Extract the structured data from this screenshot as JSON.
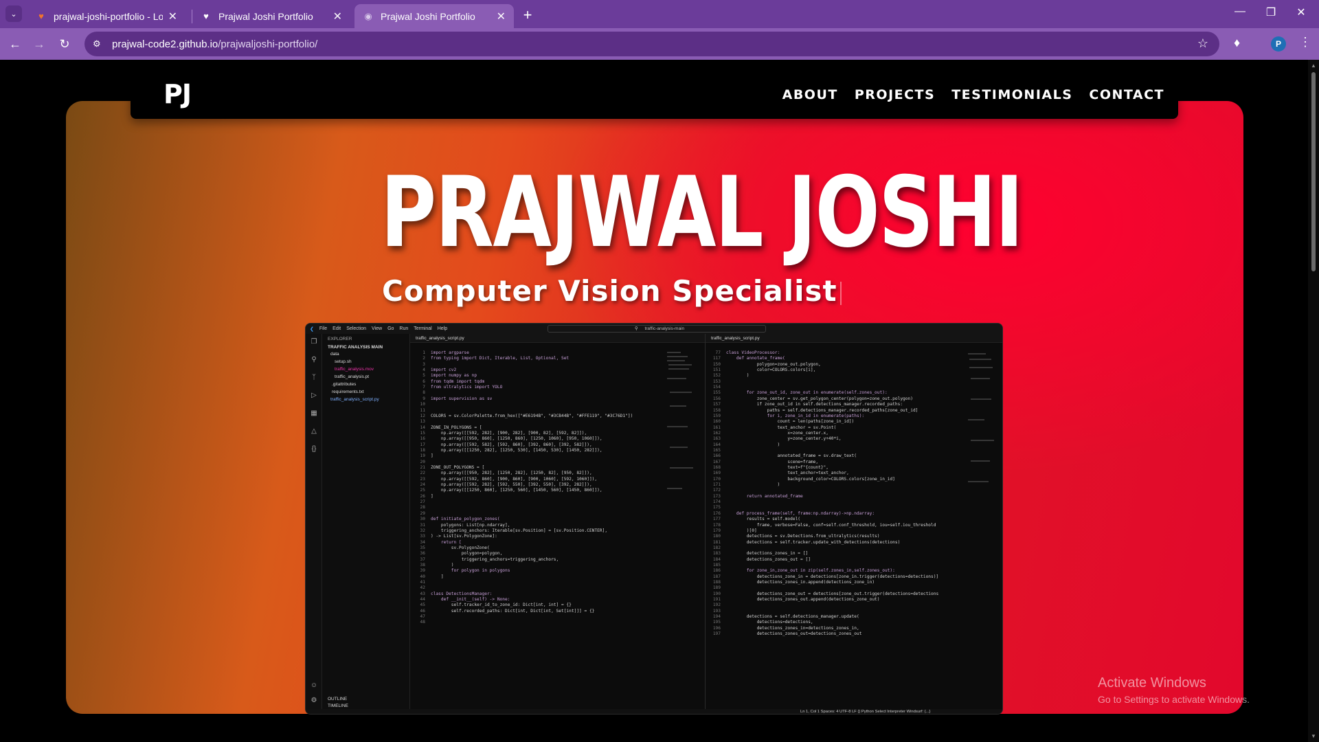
{
  "browser": {
    "tabs": [
      {
        "title": "prajwal-joshi-portfolio - Lovabl",
        "favicon": "lovable-heart-icon",
        "active": false
      },
      {
        "title": "Prajwal Joshi Portfolio",
        "favicon": "heart-icon",
        "active": false
      },
      {
        "title": "Prajwal Joshi Portfolio",
        "favicon": "globe-icon",
        "active": true
      }
    ],
    "url_host": "prajwal-code2.github.io",
    "url_path": "/prajwaljoshi-portfolio/",
    "profile_initial": "P",
    "colors": {
      "frame": "#6b3c9a",
      "toolbar": "#8a5cb4",
      "omnibox": "#5c2f86"
    }
  },
  "site": {
    "logo": "PJ",
    "nav": [
      "ABOUT",
      "PROJECTS",
      "TESTIMONIALS",
      "CONTACT"
    ],
    "hero_name": "PRAJWAL JOSHI",
    "hero_role": "Computer Vision Specialist",
    "colors": {
      "accent_red": "#e2082c",
      "accent_orange": "#d85a1a"
    }
  },
  "ide": {
    "menu": [
      "File",
      "Edit",
      "Selection",
      "View",
      "Go",
      "Run",
      "Terminal",
      "Help"
    ],
    "search": "traffic-analysis-main",
    "explorer_header": "EXPLORER",
    "project": "TRAFFIC ANALYSIS MAIN",
    "files": [
      "data",
      "setup.sh",
      "traffic_analysis.mov",
      "traffic_analysis.pt",
      ".gitattributes",
      "requirements.txt",
      "traffic_analysis_script.py"
    ],
    "outline": "OUTLINE",
    "timeline": "TIMELINE",
    "tab_left": "traffic_analysis_script.py",
    "tab_right": "traffic_analysis_script.py",
    "left_lines": [
      [
        "1",
        "import argparse"
      ],
      [
        "2",
        "from typing import Dict, Iterable, List, Optional, Set"
      ],
      [
        "3",
        ""
      ],
      [
        "4",
        "import cv2"
      ],
      [
        "5",
        "import numpy as np"
      ],
      [
        "6",
        "from tqdm import tqdm"
      ],
      [
        "7",
        "from ultralytics import YOLO"
      ],
      [
        "8",
        ""
      ],
      [
        "9",
        "import supervision as sv"
      ],
      [
        "10",
        ""
      ],
      [
        "11",
        ""
      ],
      [
        "12",
        "COLORS = sv.ColorPalette.from_hex([\"#E6194B\", \"#3CB44B\", \"#FFE119\", \"#3C76D1\"])"
      ],
      [
        "13",
        ""
      ],
      [
        "14",
        "ZONE_IN_POLYGONS = ["
      ],
      [
        "15",
        "    np.array([[592, 282], [900, 282], [900, 82], [592, 82]]),"
      ],
      [
        "16",
        "    np.array([[950, 860], [1250, 860], [1250, 1060], [950, 1060]]),"
      ],
      [
        "17",
        "    np.array([[592, 582], [592, 860], [392, 860], [392, 582]]),"
      ],
      [
        "18",
        "    np.array([[1250, 282], [1250, 530], [1450, 530], [1450, 282]]),"
      ],
      [
        "19",
        "]"
      ],
      [
        "20",
        ""
      ],
      [
        "21",
        "ZONE_OUT_POLYGONS = ["
      ],
      [
        "22",
        "    np.array([[950, 282], [1250, 282], [1250, 82], [950, 82]]),"
      ],
      [
        "23",
        "    np.array([[592, 860], [900, 860], [900, 1060], [592, 1060]]),"
      ],
      [
        "24",
        "    np.array([[592, 282], [592, 550], [392, 550], [392, 282]]),"
      ],
      [
        "25",
        "    np.array([[1250, 860], [1250, 560], [1450, 560], [1450, 860]]),"
      ],
      [
        "26",
        "]"
      ],
      [
        "27",
        ""
      ],
      [
        "28",
        ""
      ],
      [
        "29",
        ""
      ],
      [
        "30",
        "def initiate_polygon_zones("
      ],
      [
        "31",
        "    polygons: List[np.ndarray],"
      ],
      [
        "32",
        "    triggering_anchors: Iterable[sv.Position] = [sv.Position.CENTER],"
      ],
      [
        "33",
        ") -> List[sv.PolygonZone]:"
      ],
      [
        "34",
        "    return ["
      ],
      [
        "35",
        "        sv.PolygonZone("
      ],
      [
        "36",
        "            polygon=polygon,"
      ],
      [
        "37",
        "            triggering_anchors=triggering_anchors,"
      ],
      [
        "38",
        "        )"
      ],
      [
        "39",
        "        for polygon in polygons"
      ],
      [
        "40",
        "    ]"
      ],
      [
        "41",
        ""
      ],
      [
        "42",
        ""
      ],
      [
        "43",
        "class DetectionsManager:"
      ],
      [
        "44",
        "    def __init__(self) -> None:"
      ],
      [
        "45",
        "        self.tracker_id_to_zone_id: Dict[int, int] = {}"
      ],
      [
        "46",
        "        self.recorded_paths: Dict[int, Dict[int, Set[int]]] = {}"
      ],
      [
        "47",
        ""
      ],
      [
        "48",
        ""
      ]
    ],
    "right_lines": [
      [
        "77",
        "class VideoProcessor:"
      ],
      [
        "117",
        "    def annotate_frame("
      ],
      [
        "150",
        "            polygon=zone_out.polygon,"
      ],
      [
        "151",
        "            color=COLORS.colors[i],"
      ],
      [
        "152",
        "        )"
      ],
      [
        "153",
        ""
      ],
      [
        "154",
        ""
      ],
      [
        "155",
        "        for zone_out_id, zone_out in enumerate(self.zones_out):"
      ],
      [
        "156",
        "            zone_center = sv.get_polygon_center(polygon=zone_out.polygon)"
      ],
      [
        "157",
        "            if zone_out_id in self.detections_manager.recorded_paths:"
      ],
      [
        "158",
        "                paths = self.detections_manager.recorded_paths[zone_out_id]"
      ],
      [
        "159",
        "                for i, zone_in_id in enumerate(paths):"
      ],
      [
        "160",
        "                    count = len(paths[zone_in_id])"
      ],
      [
        "161",
        "                    text_anchor = sv.Point("
      ],
      [
        "162",
        "                        x=zone_center.x,"
      ],
      [
        "163",
        "                        y=zone_center.y+40*i,"
      ],
      [
        "164",
        "                    )"
      ],
      [
        "165",
        ""
      ],
      [
        "166",
        "                    annotated_frame = sv.draw_text("
      ],
      [
        "167",
        "                        scene=frame,"
      ],
      [
        "168",
        "                        text=f\"{count}\","
      ],
      [
        "169",
        "                        text_anchor=text_anchor,"
      ],
      [
        "170",
        "                        background_color=COLORS.colors[zone_in_id]"
      ],
      [
        "171",
        "                    )"
      ],
      [
        "172",
        ""
      ],
      [
        "173",
        "        return annotated_frame"
      ],
      [
        "174",
        ""
      ],
      [
        "175",
        ""
      ],
      [
        "176",
        "    def process_frame(self, frame:np.ndarray)->np.ndarray:"
      ],
      [
        "177",
        "        results = self.model("
      ],
      [
        "178",
        "            frame, verbose=False, conf=self.conf_threshold, iou=self.iou_threshold"
      ],
      [
        "179",
        "        )[0]"
      ],
      [
        "180",
        "        detections = sv.Detections.from_ultralytics(results)"
      ],
      [
        "181",
        "        detections = self.tracker.update_with_detections(detections)"
      ],
      [
        "182",
        ""
      ],
      [
        "183",
        "        detections_zones_in = []"
      ],
      [
        "184",
        "        detections_zones_out = []"
      ],
      [
        "185",
        ""
      ],
      [
        "186",
        "        for zone_in,zone_out in zip(self.zones_in,self.zones_out):"
      ],
      [
        "187",
        "            detections_zone_in = detections[zone_in.trigger(detections=detections)]"
      ],
      [
        "188",
        "            detections_zones_in.append(detections_zone_in)"
      ],
      [
        "189",
        ""
      ],
      [
        "190",
        "            detections_zone_out = detections[zone_out.trigger(detections=detections"
      ],
      [
        "191",
        "            detections_zones_out.append(detections_zone_out)"
      ],
      [
        "192",
        ""
      ],
      [
        "193",
        ""
      ],
      [
        "194",
        "        detections = self.detections_manager.update("
      ],
      [
        "195",
        "            detections=detections,"
      ],
      [
        "196",
        "            detections_zones_in=detections_zones_in,"
      ],
      [
        "197",
        "            detections_zones_out=detections_zones_out"
      ]
    ],
    "status": "Ln 1, Col 1   Spaces: 4   UTF-8   LF   {} Python   Select Interpreter   Windsurf: {...}"
  },
  "watermark": {
    "title": "Activate Windows",
    "subtitle": "Go to Settings to activate Windows."
  }
}
